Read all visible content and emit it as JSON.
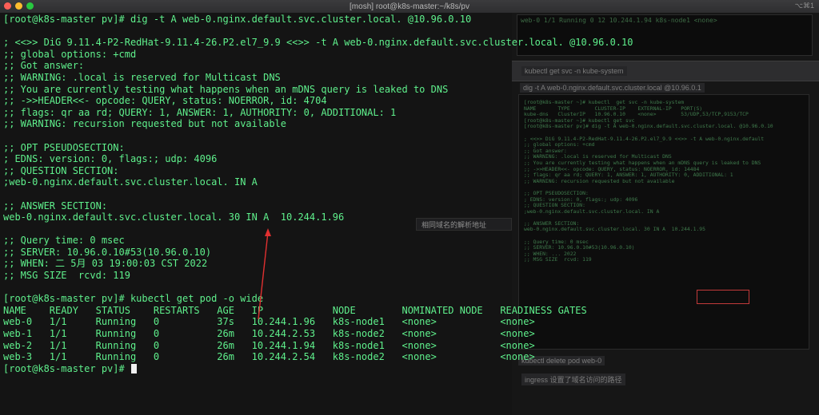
{
  "window": {
    "title": "[mosh] root@k8s-master:~/k8s/pv",
    "shortcut": "⌥⌘1",
    "traffic_lights": [
      "#ff5f57",
      "#febc2e",
      "#28c840"
    ]
  },
  "terminal": {
    "lines": [
      {
        "text": "[root@k8s-master pv]# dig -t A web-0.nginx.default.svc.cluster.local. @10.96.0.10"
      },
      {
        "text": ""
      },
      {
        "text": "; <<>> DiG 9.11.4-P2-RedHat-9.11.4-26.P2.el7_9.9 <<>> -t A web-0.nginx.default.svc.cluster.local. @10.96.0.10"
      },
      {
        "text": ";; global options: +cmd"
      },
      {
        "text": ";; Got answer:"
      },
      {
        "text": ";; WARNING: .local is reserved for Multicast DNS"
      },
      {
        "text": ";; You are currently testing what happens when an mDNS query is leaked to DNS"
      },
      {
        "text": ";; ->>HEADER<<- opcode: QUERY, status: NOERROR, id: 4704"
      },
      {
        "text": ";; flags: qr aa rd; QUERY: 1, ANSWER: 1, AUTHORITY: 0, ADDITIONAL: 1"
      },
      {
        "text": ";; WARNING: recursion requested but not available"
      },
      {
        "text": ""
      },
      {
        "text": ";; OPT PSEUDOSECTION:"
      },
      {
        "text": "; EDNS: version: 0, flags:; udp: 4096"
      },
      {
        "text": ";; QUESTION SECTION:"
      },
      {
        "text": ";web-0.nginx.default.svc.cluster.local. IN A"
      },
      {
        "text": ""
      },
      {
        "text": ";; ANSWER SECTION:"
      },
      {
        "text": "web-0.nginx.default.svc.cluster.local. 30 IN A  10.244.1.96"
      },
      {
        "text": ""
      },
      {
        "text": ";; Query time: 0 msec"
      },
      {
        "text": ";; SERVER: 10.96.0.10#53(10.96.0.10)"
      },
      {
        "text": ";; WHEN: 二 5月 03 19:00:03 CST 2022"
      },
      {
        "text": ";; MSG SIZE  rcvd: 119"
      },
      {
        "text": ""
      },
      {
        "text": "[root@k8s-master pv]# kubectl get pod -o wide"
      },
      {
        "text": "NAME    READY   STATUS    RESTARTS   AGE   IP            NODE        NOMINATED NODE   READINESS GATES"
      },
      {
        "text": "web-0   1/1     Running   0          37s   10.244.1.96   k8s-node1   <none>           <none>"
      },
      {
        "text": "web-1   1/1     Running   0          26m   10.244.2.53   k8s-node2   <none>           <none>"
      },
      {
        "text": "web-2   1/1     Running   0          26m   10.244.1.94   k8s-node1   <none>           <none>"
      },
      {
        "text": "web-3   1/1     Running   0          26m   10.244.2.54   k8s-node2   <none>           <none>"
      },
      {
        "text": "[root@k8s-master pv]# "
      }
    ]
  },
  "background": {
    "labels": {
      "svc_label": "kubectl  get svc -n kube-system",
      "dig_label": "dig -t A web-0.nginx.default.svc.cluster.local  @10.96.0.1",
      "delete_label": "kubectl delete  pod web-0",
      "ingress_label": "ingress 设置了域名访问的路径",
      "mid_label": "相同域名的解析地址"
    },
    "mini_lines": [
      "[root@k8s-master ~]# kubectl  get svc -n kube-system",
      "NAME       TYPE        CLUSTER-IP    EXTERNAL-IP   PORT(S)",
      "kube-dns   ClusterIP   10.96.0.10    <none>        53/UDP,53/TCP,9153/TCP",
      "[root@k8s-master ~]# kubectl get svc",
      "[root@k8s-master pv]# dig -t A web-0.nginx.default.svc.cluster.local. @10.96.0.10",
      "",
      "; <<>> DiG 9.11.4-P2-RedHat-9.11.4-26.P2.el7_9.9 <<>> -t A web-0.nginx.default",
      ";; global options: +cmd",
      ";; Got answer:",
      ";; WARNING: .local is reserved for Multicast DNS",
      ";; You are currently testing what happens when an mDNS query is leaked to DNS",
      ";; ->>HEADER<<- opcode: QUERY, status: NOERROR, id: 14484",
      ";; flags: qr aa rd; QUERY: 1, ANSWER: 1, AUTHORITY: 0, ADDITIONAL: 1",
      ";; WARNING: recursion requested but not available",
      "",
      ";; OPT PSEUDOSECTION:",
      "; EDNS: version: 0, flags:; udp: 4096",
      ";; QUESTION SECTION:",
      ";web-0.nginx.default.svc.cluster.local. IN A",
      "",
      ";; ANSWER SECTION:",
      "web-0.nginx.default.svc.cluster.local. 30 IN A  10.244.1.95",
      "",
      ";; Query time: 0 msec",
      ";; SERVER: 10.96.0.10#53(10.96.0.10)",
      ";; WHEN: ... 2022",
      ";; MSG SIZE  rcvd: 119"
    ],
    "top_thumb_text": "web-0  1/1   Running  0   12   10.244.1.94  k8s-node1  <none>"
  }
}
